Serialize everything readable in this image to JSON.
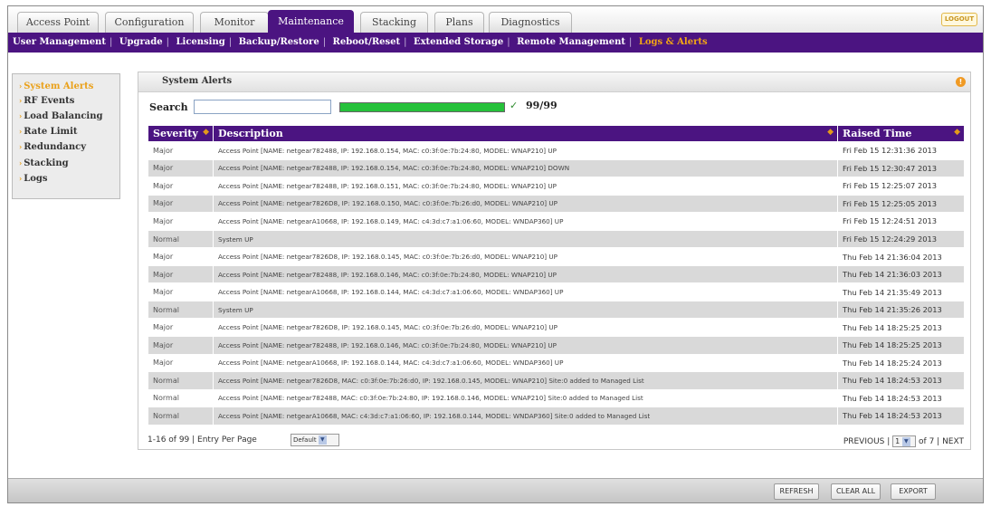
{
  "tabs": [
    "Access Point",
    "Configuration",
    "Monitor",
    "Maintenance",
    "Stacking",
    "Plans",
    "Diagnostics"
  ],
  "active_tab": "Maintenance",
  "logout_label": "LOGOUT",
  "submenu": [
    "User Management",
    "Upgrade",
    "Licensing",
    "Backup/Restore",
    "Reboot/Reset",
    "Extended Storage",
    "Remote Management",
    "Logs & Alerts"
  ],
  "active_submenu": "Logs & Alerts",
  "leftnav": [
    "System Alerts",
    "RF Events",
    "Load Balancing",
    "Rate Limit",
    "Redundancy",
    "Stacking",
    "Logs"
  ],
  "active_leftnav": "System Alerts",
  "panel": {
    "title": "System Alerts",
    "help_icon": "!"
  },
  "search": {
    "label": "Search",
    "value": "",
    "progress_fraction": 1.0,
    "count": "99/99",
    "check": "✓"
  },
  "table": {
    "headers": {
      "severity": "Severity",
      "description": "Description",
      "time": "Raised Time"
    },
    "rows": [
      [
        "Major",
        "Access Point [NAME: netgear782488, IP: 192.168.0.154, MAC: c0:3f:0e:7b:24:80, MODEL: WNAP210] UP",
        "Fri Feb 15 12:31:36 2013"
      ],
      [
        "Major",
        "Access Point [NAME: netgear782488, IP: 192.168.0.154, MAC: c0:3f:0e:7b:24:80, MODEL: WNAP210] DOWN",
        "Fri Feb 15 12:30:47 2013"
      ],
      [
        "Major",
        "Access Point [NAME: netgear782488, IP: 192.168.0.151, MAC: c0:3f:0e:7b:24:80, MODEL: WNAP210] UP",
        "Fri Feb 15 12:25:07 2013"
      ],
      [
        "Major",
        "Access Point [NAME: netgear7826D8, IP: 192.168.0.150, MAC: c0:3f:0e:7b:26:d0, MODEL: WNAP210] UP",
        "Fri Feb 15 12:25:05 2013"
      ],
      [
        "Major",
        "Access Point [NAME: netgearA10668, IP: 192.168.0.149, MAC: c4:3d:c7:a1:06:60, MODEL: WNDAP360] UP",
        "Fri Feb 15 12:24:51 2013"
      ],
      [
        "Normal",
        "System UP",
        "Fri Feb 15 12:24:29 2013"
      ],
      [
        "Major",
        "Access Point [NAME: netgear7826D8, IP: 192.168.0.145, MAC: c0:3f:0e:7b:26:d0, MODEL: WNAP210] UP",
        "Thu Feb 14 21:36:04 2013"
      ],
      [
        "Major",
        "Access Point [NAME: netgear782488, IP: 192.168.0.146, MAC: c0:3f:0e:7b:24:80, MODEL: WNAP210] UP",
        "Thu Feb 14 21:36:03 2013"
      ],
      [
        "Major",
        "Access Point [NAME: netgearA10668, IP: 192.168.0.144, MAC: c4:3d:c7:a1:06:60, MODEL: WNDAP360] UP",
        "Thu Feb 14 21:35:49 2013"
      ],
      [
        "Normal",
        "System UP",
        "Thu Feb 14 21:35:26 2013"
      ],
      [
        "Major",
        "Access Point [NAME: netgear7826D8, IP: 192.168.0.145, MAC: c0:3f:0e:7b:26:d0, MODEL: WNAP210] UP",
        "Thu Feb 14 18:25:25 2013"
      ],
      [
        "Major",
        "Access Point [NAME: netgear782488, IP: 192.168.0.146, MAC: c0:3f:0e:7b:24:80, MODEL: WNAP210] UP",
        "Thu Feb 14 18:25:25 2013"
      ],
      [
        "Major",
        "Access Point [NAME: netgearA10668, IP: 192.168.0.144, MAC: c4:3d:c7:a1:06:60, MODEL: WNDAP360] UP",
        "Thu Feb 14 18:25:24 2013"
      ],
      [
        "Normal",
        "Access Point [NAME: netgear7826D8, MAC: c0:3f:0e:7b:26:d0, IP: 192.168.0.145, MODEL: WNAP210] Site:0 added to Managed List",
        "Thu Feb 14 18:24:53 2013"
      ],
      [
        "Normal",
        "Access Point [NAME: netgear782488, MAC: c0:3f:0e:7b:24:80, IP: 192.168.0.146, MODEL: WNAP210] Site:0 added to Managed List",
        "Thu Feb 14 18:24:53 2013"
      ],
      [
        "Normal",
        "Access Point [NAME: netgearA10668, MAC: c4:3d:c7:a1:06:60, IP: 192.168.0.144, MODEL: WNDAP360] Site:0 added to Managed List",
        "Thu Feb 14 18:24:53 2013"
      ]
    ]
  },
  "footer": {
    "range_text": "1-16 of 99 | Entry Per Page",
    "per_page_value": "Default",
    "previous": "PREVIOUS |",
    "page_value": "1",
    "of_pages": "of 7 |",
    "next": "NEXT"
  },
  "buttons": {
    "refresh": "REFRESH",
    "clear_all": "CLEAR ALL",
    "export": "EXPORT"
  },
  "colors": {
    "accent": "#4b1481",
    "highlight": "#eaa11b",
    "progress": "#25c13a"
  }
}
